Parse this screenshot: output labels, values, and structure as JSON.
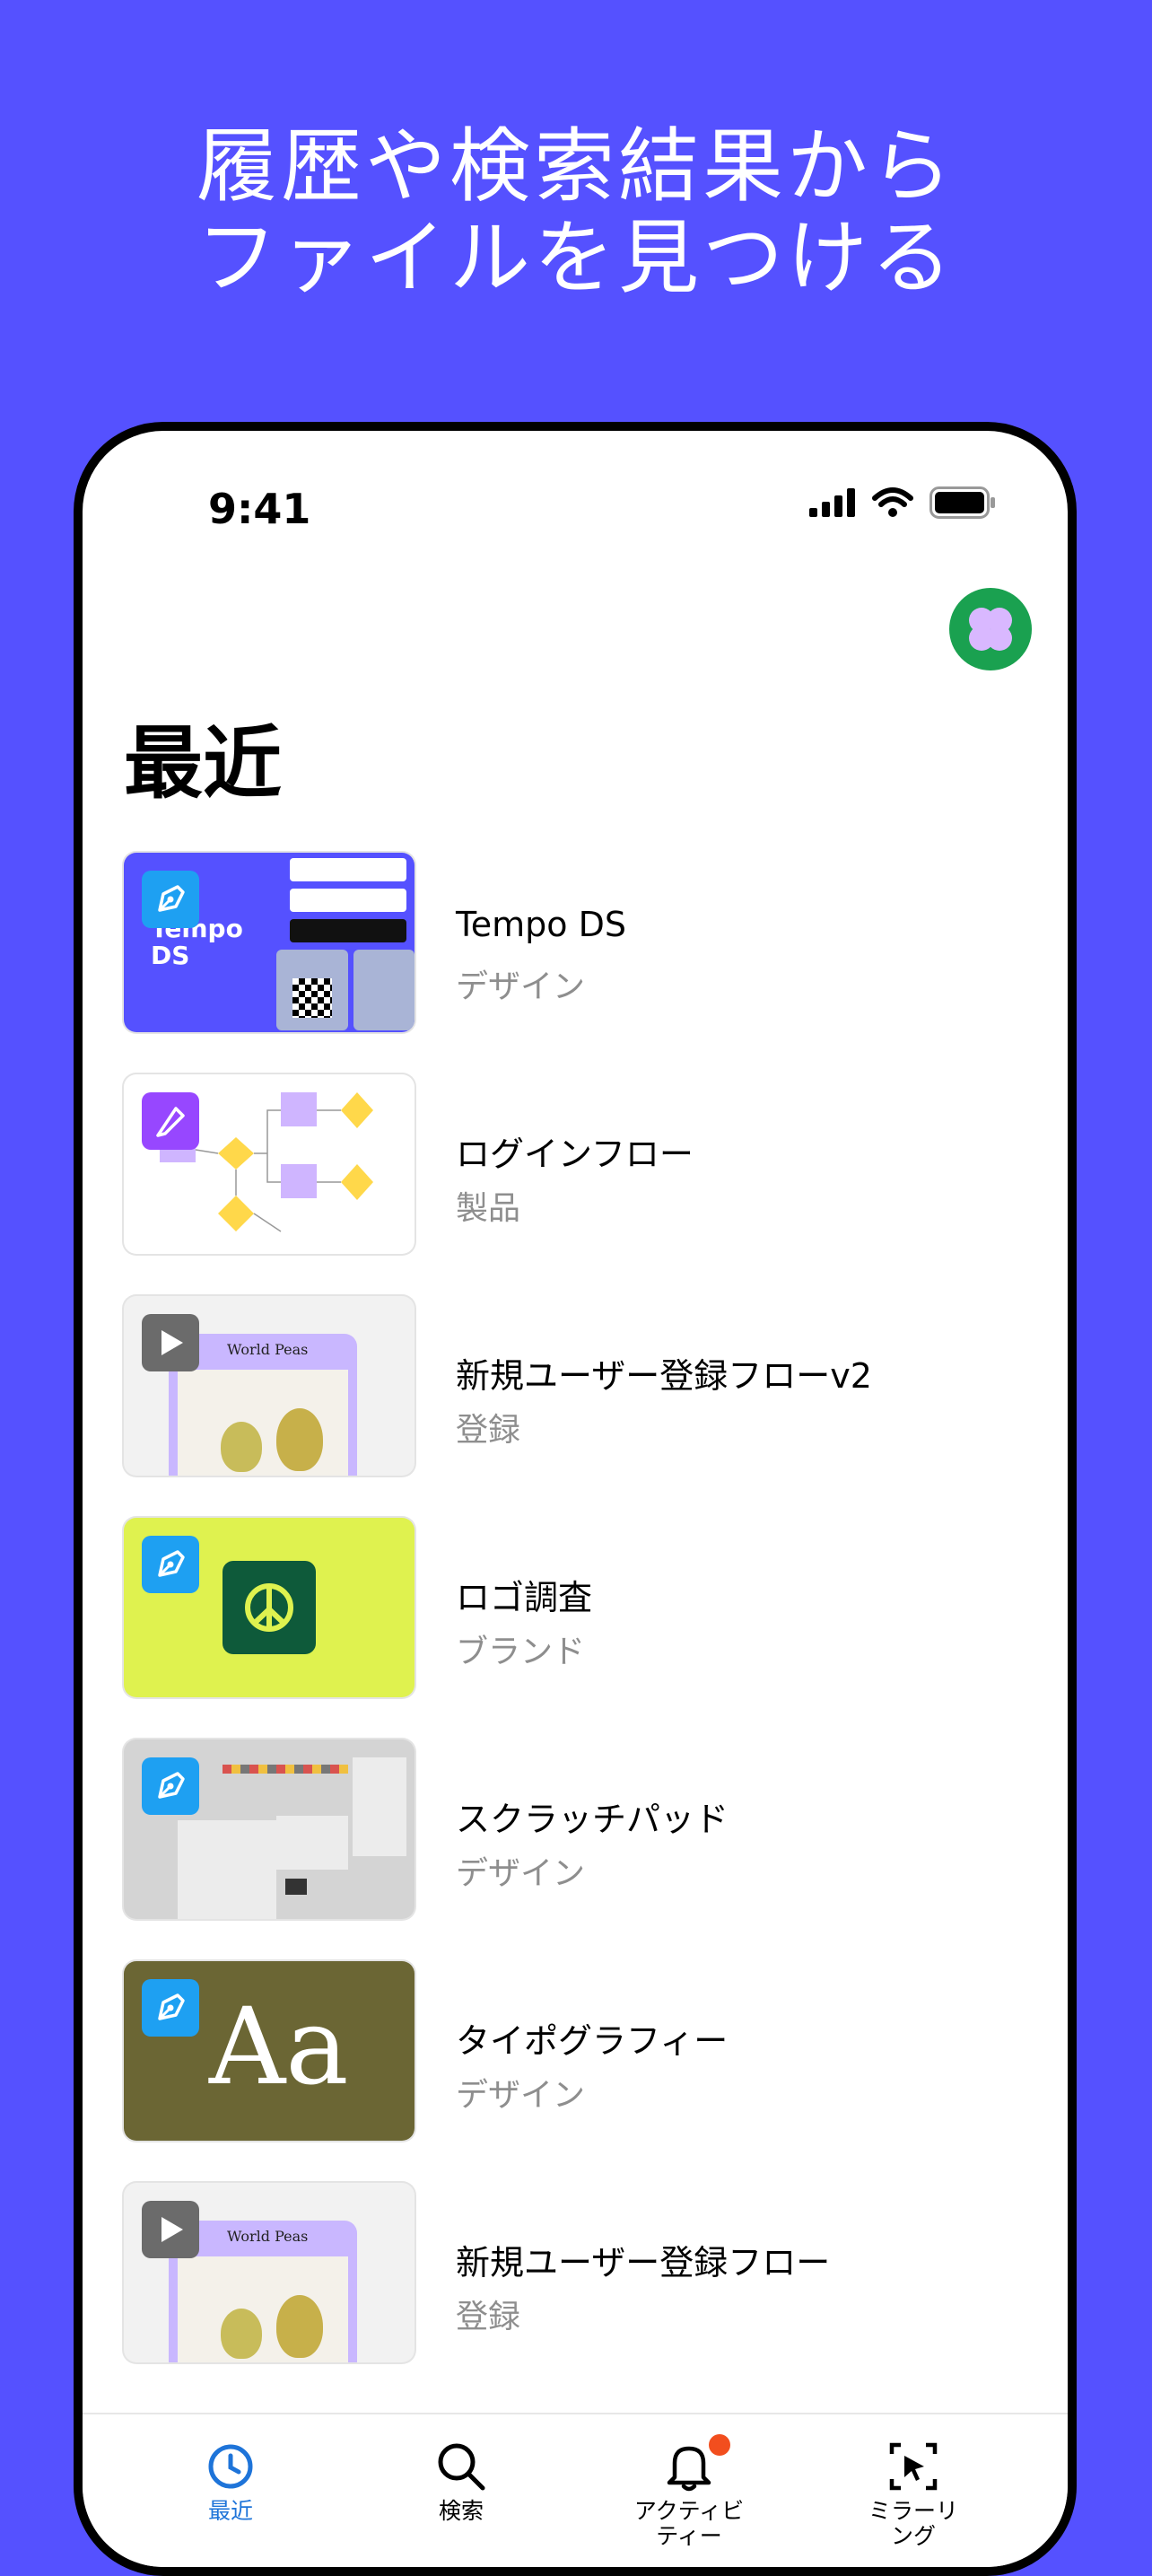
{
  "promo": {
    "line1": "履歴や検索結果から",
    "line2": "ファイルを見つける"
  },
  "status": {
    "time": "9:41"
  },
  "page": {
    "title": "最近"
  },
  "files": [
    {
      "title": "Tempo DS",
      "team": "デザイン",
      "type": "design",
      "thumb_text": "Tempo DS"
    },
    {
      "title": "ログインフロー",
      "team": "製品",
      "type": "figjam"
    },
    {
      "title": "新規ユーザー登録フローv2",
      "team": "登録",
      "type": "prototype",
      "thumb_text": "World Peas"
    },
    {
      "title": "ロゴ調査",
      "team": "ブランド",
      "type": "design"
    },
    {
      "title": "スクラッチパッド",
      "team": "デザイン",
      "type": "design"
    },
    {
      "title": "タイポグラフィー",
      "team": "デザイン",
      "type": "design",
      "thumb_text": "Aa"
    },
    {
      "title": "新規ユーザー登録フロー",
      "team": "登録",
      "type": "prototype",
      "thumb_text": "World Peas"
    }
  ],
  "tabs": [
    {
      "label": "最近",
      "icon": "clock-icon",
      "active": true
    },
    {
      "label": "検索",
      "icon": "search-icon",
      "active": false
    },
    {
      "label": "アクティビ\nティー",
      "label_line1": "アクティビ",
      "label_line2": "ティー",
      "icon": "bell-icon",
      "active": false
    },
    {
      "label": "ミラーリ\nング",
      "label_line1": "ミラーリ",
      "label_line2": "ング",
      "icon": "mirror-icon",
      "active": false
    }
  ],
  "colors": {
    "background": "#5551ff",
    "accent": "#1e74d9",
    "avatar": "#1aa150",
    "notification": "#f24e1e"
  }
}
